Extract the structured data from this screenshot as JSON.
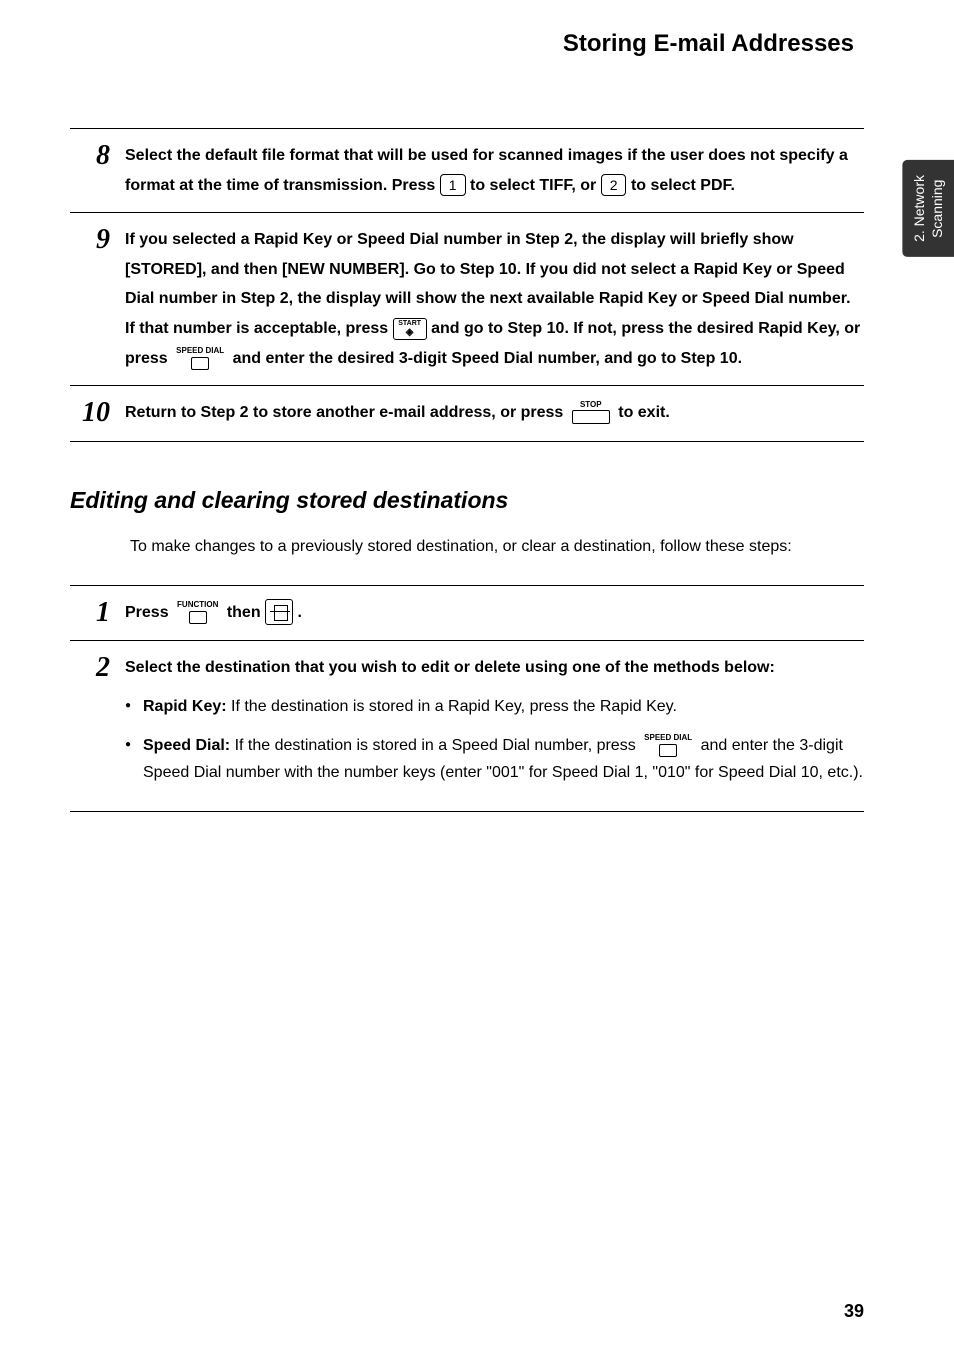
{
  "header": {
    "title": "Storing E-mail Addresses"
  },
  "sideTab": {
    "line1": "2. Network",
    "line2": "Scanning"
  },
  "steps1": [
    {
      "num": "8",
      "parts": {
        "t1": "Select the default file format that will be used for scanned images if the user does not specify a format at the time of transmission. Press ",
        "k1": "1",
        "t2": " to select TIFF, or ",
        "k2": "2",
        "t3": " to select PDF."
      }
    },
    {
      "num": "9",
      "parts": {
        "t1": "If you  selected a Rapid Key or Speed Dial number in Step 2, the display will briefly show [STORED], and then [NEW NUMBER]. Go to Step 10. If you did not select a Rapid Key or Speed Dial number in Step 2, the display will show the next available Rapid Key or Speed Dial number. If that number is acceptable, press ",
        "startLabel": "START",
        "t2": " and go to Step 10. If not, press the desired Rapid Key, or press ",
        "speedLabel": "SPEED DIAL",
        "t3": " and enter the desired 3-digit Speed Dial number, and go to Step 10."
      }
    },
    {
      "num": "10",
      "parts": {
        "t1": "Return to Step 2 to store another e-mail address, or press ",
        "stopLabel": "STOP",
        "t2": " to exit."
      }
    }
  ],
  "section2": {
    "heading": "Editing and clearing stored destinations",
    "intro": "To make changes to a previously stored destination, or clear a destination, follow these steps:"
  },
  "steps2": [
    {
      "num": "1",
      "parts": {
        "t1": "Press ",
        "funcLabel": "FUNCTION",
        "t2": " then ",
        "t3": "."
      }
    },
    {
      "num": "2",
      "parts": {
        "t1": "Select the destination that you wish to edit or delete using one of the methods below:",
        "bullets": [
          {
            "label": "Rapid Key:",
            "text": " If the destination is stored in a Rapid Key, press the Rapid Key."
          },
          {
            "label": "Speed Dial:",
            "text1": " If the destination is stored in a Speed Dial number, press ",
            "speedLabel": "SPEED DIAL",
            "text2": " and enter the 3-digit Speed Dial number with the number keys (enter \"001\" for Speed Dial 1, \"010\" for Speed Dial 10, etc.)."
          }
        ]
      }
    }
  ],
  "pageNumber": "39"
}
